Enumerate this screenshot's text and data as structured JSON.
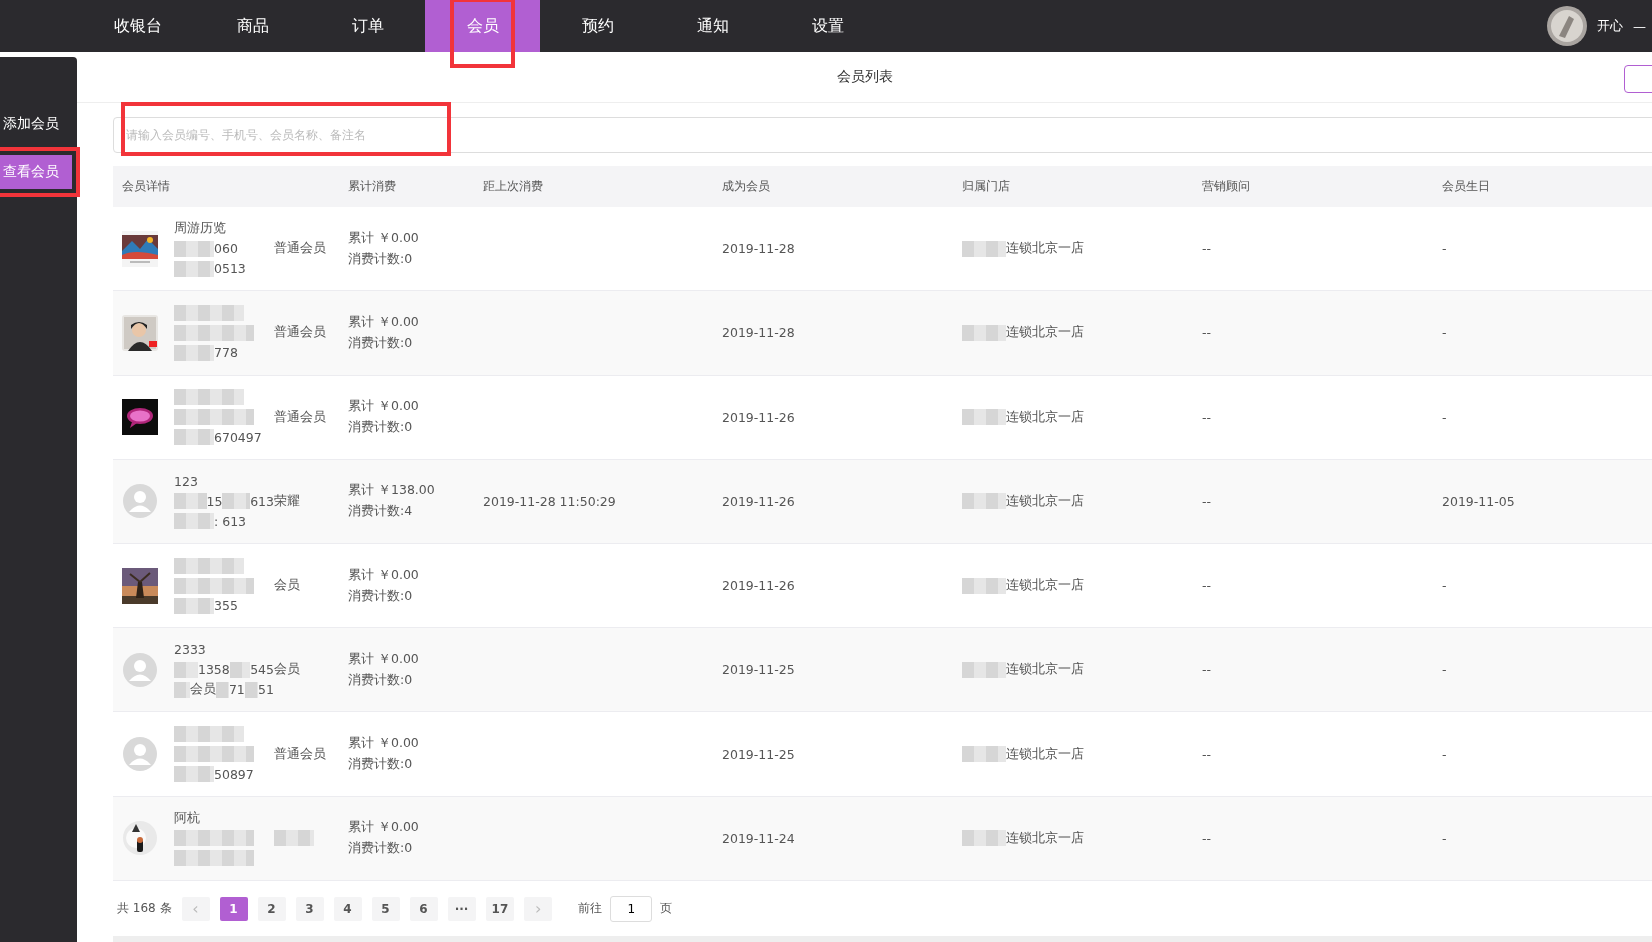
{
  "nav": {
    "items": [
      {
        "label": "收银台",
        "selected": false,
        "highlight": false
      },
      {
        "label": "商品",
        "selected": false,
        "highlight": false
      },
      {
        "label": "订单",
        "selected": false,
        "highlight": false
      },
      {
        "label": "会员",
        "selected": true,
        "highlight": true
      },
      {
        "label": "预约",
        "selected": false,
        "highlight": false
      },
      {
        "label": "通知",
        "selected": false,
        "highlight": false
      },
      {
        "label": "设置",
        "selected": false,
        "highlight": false
      }
    ],
    "user": {
      "name": "开心",
      "menu": "—"
    }
  },
  "sidebar": {
    "items": [
      {
        "label": "添加会员",
        "selected": false,
        "highlight": false
      },
      {
        "label": "查看会员",
        "selected": true,
        "highlight": true
      }
    ]
  },
  "page_title": "会员列表",
  "search": {
    "placeholder": "请输入会员编号、手机号、会员名称、备注名",
    "highlight": true
  },
  "table": {
    "columns": [
      "会员详情",
      "累计消费",
      "距上次消费",
      "成为会员",
      "归属门店",
      "营销顾问",
      "会员生日"
    ],
    "rows": [
      {
        "avatar": {
          "kind": "picture"
        },
        "name": [
          "周游历览"
        ],
        "phone": [
          "060"
        ],
        "level": "普通会员",
        "code": [
          "0513"
        ],
        "total": "累计 ￥0.00",
        "count": "消费计数:0",
        "since": "2019-11-28",
        "store": "连锁北京一店",
        "advisor": "--",
        "birthday": "-"
      },
      {
        "avatar": {
          "kind": "picture"
        },
        "level": "普通会员",
        "code": [
          "778"
        ],
        "total": "累计 ￥0.00",
        "count": "消费计数:0",
        "since": "2019-11-28",
        "store": "连锁北京一店",
        "advisor": "--",
        "birthday": "-"
      },
      {
        "avatar": {
          "kind": "picture"
        },
        "level": "普通会员",
        "code": [
          "670497"
        ],
        "total": "累计 ￥0.00",
        "count": "消费计数:0",
        "since": "2019-11-26",
        "store": "连锁北京一店",
        "advisor": "--",
        "birthday": "-"
      },
      {
        "avatar": {
          "kind": "placeholder"
        },
        "name": [
          "123"
        ],
        "phone": [
          "15",
          "613"
        ],
        "level": "荣耀",
        "code": [
          ": 613"
        ],
        "total": "累计 ￥138.00",
        "count": "消费计数:4",
        "last": "2019-11-28 11:50:29",
        "since": "2019-11-26",
        "store": "连锁北京一店",
        "advisor": "--",
        "birthday": "2019-11-05"
      },
      {
        "avatar": {
          "kind": "picture"
        },
        "level": "会员",
        "code": [
          "355"
        ],
        "total": "累计 ￥0.00",
        "count": "消费计数:0",
        "since": "2019-11-26",
        "store": "连锁北京一店",
        "advisor": "--",
        "birthday": "-"
      },
      {
        "avatar": {
          "kind": "placeholder"
        },
        "name": [
          "2333"
        ],
        "phone": [
          "1358",
          "545"
        ],
        "level": "会员",
        "code": [
          "会员",
          "71",
          "51"
        ],
        "total": "累计 ￥0.00",
        "count": "消费计数:0",
        "since": "2019-11-25",
        "store": "连锁北京一店",
        "advisor": "--",
        "birthday": "-"
      },
      {
        "avatar": {
          "kind": "placeholder"
        },
        "level": "普通会员",
        "code": [
          "50897"
        ],
        "total": "累计 ￥0.00",
        "count": "消费计数:0",
        "since": "2019-11-25",
        "store": "连锁北京一店",
        "advisor": "--",
        "birthday": "-"
      },
      {
        "avatar": {
          "kind": "picture"
        },
        "name": [
          "阿杭"
        ],
        "total": "累计 ￥0.00",
        "count": "消费计数:0",
        "since": "2019-11-24",
        "store": "连锁北京一店",
        "advisor": "--",
        "birthday": "-"
      }
    ]
  },
  "pagination": {
    "total": "共 168 条",
    "prev": "‹",
    "next": "›",
    "pages": [
      {
        "label": "1",
        "selected": true
      },
      {
        "label": "2",
        "selected": false
      },
      {
        "label": "3",
        "selected": false
      },
      {
        "label": "4",
        "selected": false
      },
      {
        "label": "5",
        "selected": false
      },
      {
        "label": "6",
        "selected": false
      },
      {
        "label": "···",
        "selected": false
      },
      {
        "label": "17",
        "selected": false
      }
    ],
    "goto_label": "前往",
    "goto_value": "1",
    "page_suffix": "页"
  }
}
